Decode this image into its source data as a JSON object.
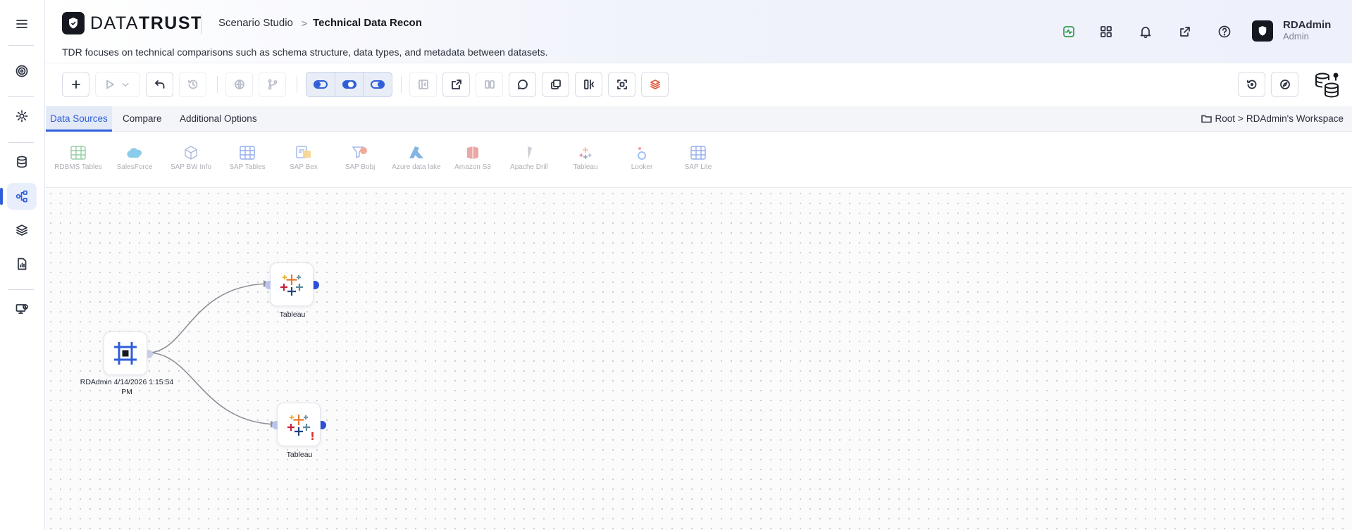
{
  "app": {
    "logo_text_light": "DATA",
    "logo_text_bold": "TRUST",
    "breadcrumb_parent": "Scenario Studio",
    "breadcrumb_separator": ">",
    "breadcrumb_current": "Technical Data Recon",
    "subtitle": "TDR focuses on technical comparisons such as schema structure, data types, and metadata between datasets."
  },
  "header_icons": [
    "activity-icon",
    "apps-grid-icon",
    "bell-icon",
    "external-link-icon",
    "help-icon"
  ],
  "user": {
    "name": "RDAdmin",
    "role": "Admin"
  },
  "sidebar": {
    "items": [
      "menu-icon",
      "target-icon",
      "settings-icon",
      "database-icon",
      "workflow-icon",
      "layers-icon",
      "report-icon",
      "monitor-icon"
    ],
    "active": "workflow-icon"
  },
  "tabs": [
    {
      "label": "Data Sources",
      "active": true
    },
    {
      "label": "Compare",
      "active": false
    },
    {
      "label": "Additional Options",
      "active": false
    }
  ],
  "workspace_path": {
    "root": "Root",
    "separator": ">",
    "workspace": "RDAdmin's Workspace"
  },
  "sources": [
    {
      "label": "RDBMS Tables"
    },
    {
      "label": "SalesForce"
    },
    {
      "label": "SAP BW Info"
    },
    {
      "label": "SAP Tables"
    },
    {
      "label": "SAP Bex"
    },
    {
      "label": "SAP Bobj"
    },
    {
      "label": "Azure data lake"
    },
    {
      "label": "Amazon S3"
    },
    {
      "label": "Apache Drill"
    },
    {
      "label": "Tableau"
    },
    {
      "label": "Looker"
    },
    {
      "label": "SAP Lite"
    }
  ],
  "canvas": {
    "nodes": [
      {
        "label": "RDAdmin 4/14/2026 1:15:54 PM",
        "type": "start"
      },
      {
        "label": "Tableau",
        "type": "tableau",
        "warning": false
      },
      {
        "label": "Tableau",
        "type": "tableau",
        "warning": true,
        "warning_text": "!"
      }
    ]
  },
  "colors": {
    "accent": "#2f5fd8",
    "port_out": "#2f4ed6",
    "port_in": "#b8c4ee",
    "warning": "#d9302c",
    "status_green": "#2e9e4f"
  }
}
